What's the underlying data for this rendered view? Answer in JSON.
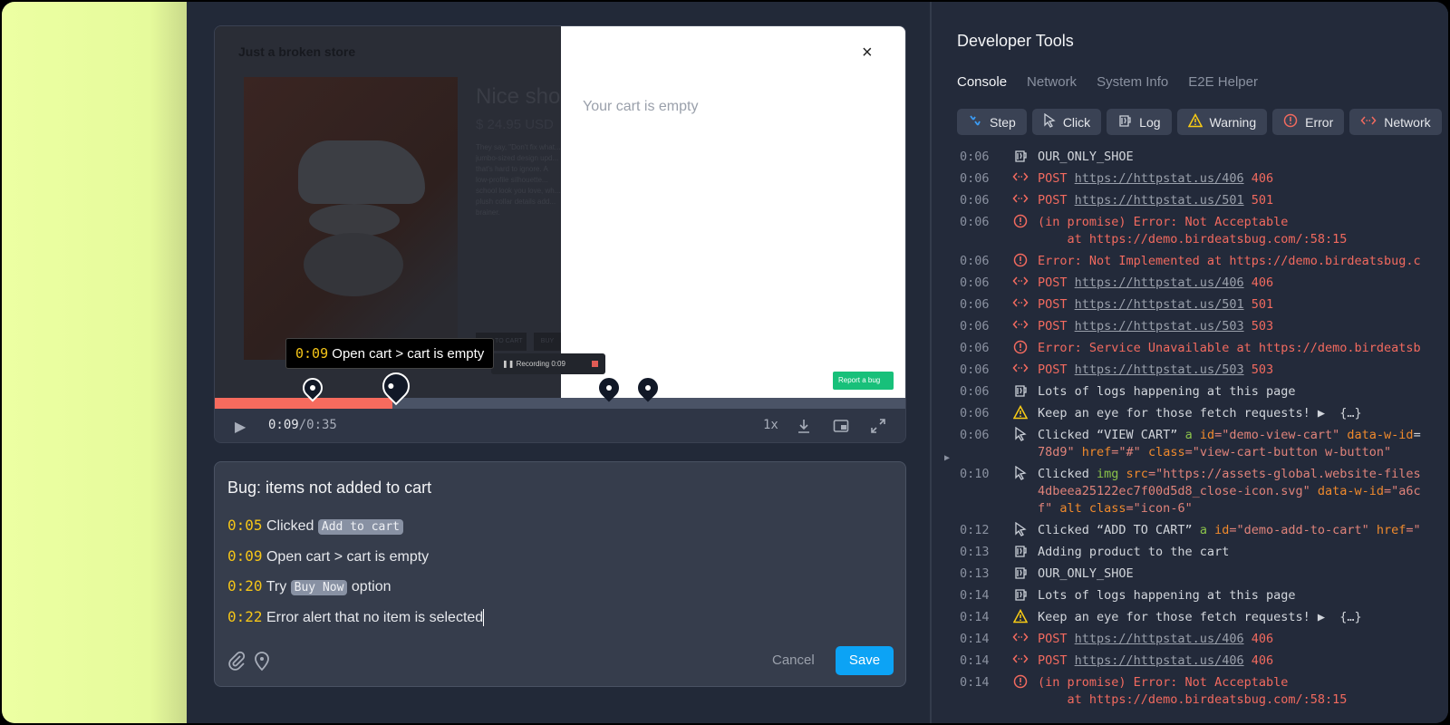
{
  "video": {
    "store_title": "Just a broken store",
    "product_title": "Nice sho",
    "price": "$ 24.95 USD",
    "description": "They say, \"Don't fix what... jumbo-sized design upd... that's hard to ignore. A low-profile silhouette... school look you love, wh... plush collar details add... brainer.",
    "add_to_cart_btn": "ADD TO CART",
    "buy_now_btn": "BUY NOW",
    "cart_empty": "Your cart is empty",
    "close_glyph": "×",
    "report_bug": "Report a bug",
    "recording_label": "Recording 0:09",
    "tooltip_time": "0:09",
    "tooltip_text": "Open cart > cart is empty",
    "progress_fraction": 0.257,
    "markers_seconds": [
      4,
      9,
      20,
      22
    ],
    "current_time": "0:09",
    "duration": "/0:35",
    "speed": "1x",
    "progress_color": "#f66b5e"
  },
  "notes": {
    "title": "Bug: items not added to cart",
    "lines": [
      {
        "time": "0:05",
        "pre": "Clicked",
        "chip": "Add to cart",
        "post": ""
      },
      {
        "time": "0:09",
        "pre": "Open cart > cart is empty",
        "chip": "",
        "post": ""
      },
      {
        "time": "0:20",
        "pre": "Try",
        "chip": "Buy Now",
        "post": "option"
      },
      {
        "time": "0:22",
        "pre": "Error alert that no item is selected",
        "chip": "",
        "post": ""
      }
    ],
    "cancel": "Cancel",
    "save": "Save",
    "save_color": "#0ca3f5"
  },
  "devtools": {
    "title": "Developer Tools",
    "tabs": [
      "Console",
      "Network",
      "System Info",
      "E2E Helper"
    ],
    "active_tab": "Console",
    "filters": [
      {
        "label": "Step",
        "icon": "step-icon"
      },
      {
        "label": "Click",
        "icon": "cursor-icon"
      },
      {
        "label": "Log",
        "icon": "log-icon"
      },
      {
        "label": "Warning",
        "icon": "warning-icon"
      },
      {
        "label": "Error",
        "icon": "error-icon"
      },
      {
        "label": "Network",
        "icon": "network-icon"
      }
    ],
    "rows": [
      {
        "time": "0:06",
        "type": "log",
        "lines": [
          [
            [
              "OUR_ONLY_SHOE",
              "text"
            ]
          ]
        ]
      },
      {
        "time": "0:06",
        "type": "network",
        "lines": [
          [
            [
              "POST ",
              "red"
            ],
            [
              "https://httpstat.us/406",
              "link"
            ],
            [
              " 406",
              "red"
            ]
          ]
        ]
      },
      {
        "time": "0:06",
        "type": "network",
        "lines": [
          [
            [
              "POST ",
              "red"
            ],
            [
              "https://httpstat.us/501",
              "link"
            ],
            [
              " 501",
              "red"
            ]
          ]
        ]
      },
      {
        "time": "0:06",
        "type": "error",
        "lines": [
          [
            [
              "(in promise) Error: Not Acceptable",
              "red"
            ]
          ],
          [
            [
              "    at https://demo.birdeatsbug.com/:58:15",
              "red"
            ]
          ]
        ]
      },
      {
        "time": "0:06",
        "type": "error",
        "lines": [
          [
            [
              "Error: Not Implemented at https://demo.birdeatsbug.c",
              "red"
            ]
          ]
        ]
      },
      {
        "time": "0:06",
        "type": "network",
        "lines": [
          [
            [
              "POST ",
              "red"
            ],
            [
              "https://httpstat.us/406",
              "link"
            ],
            [
              " 406",
              "red"
            ]
          ]
        ]
      },
      {
        "time": "0:06",
        "type": "network",
        "lines": [
          [
            [
              "POST ",
              "red"
            ],
            [
              "https://httpstat.us/501",
              "link"
            ],
            [
              " 501",
              "red"
            ]
          ]
        ]
      },
      {
        "time": "0:06",
        "type": "network",
        "lines": [
          [
            [
              "POST ",
              "red"
            ],
            [
              "https://httpstat.us/503",
              "link"
            ],
            [
              " 503",
              "red"
            ]
          ]
        ]
      },
      {
        "time": "0:06",
        "type": "error",
        "lines": [
          [
            [
              "Error: Service Unavailable at https://demo.birdeatsb",
              "red"
            ]
          ]
        ]
      },
      {
        "time": "0:06",
        "type": "network",
        "lines": [
          [
            [
              "POST ",
              "red"
            ],
            [
              "https://httpstat.us/503",
              "link"
            ],
            [
              " 503",
              "red"
            ]
          ]
        ]
      },
      {
        "time": "0:06",
        "type": "log",
        "lines": [
          [
            [
              "Lots of logs happening at this page",
              "text"
            ]
          ]
        ]
      },
      {
        "time": "0:06",
        "type": "warning",
        "lines": [
          [
            [
              "Keep an eye for those fetch requests! ▶  {…}",
              "text"
            ]
          ]
        ]
      },
      {
        "time": "0:06",
        "type": "click",
        "lines": [
          [
            [
              "Clicked “VIEW CART” ",
              "text"
            ],
            [
              "a ",
              "tag"
            ],
            [
              "id",
              "attr"
            ],
            [
              "=\"demo-view-cart\" ",
              "val"
            ],
            [
              "data-w-id",
              "attr"
            ],
            [
              "=",
              "text"
            ]
          ],
          [
            [
              "78d9\" ",
              "val"
            ],
            [
              "href",
              "attr"
            ],
            [
              "=\"#\" ",
              "val"
            ],
            [
              "class",
              "attr"
            ],
            [
              "=\"view-cart-button w-button\"",
              "val"
            ]
          ]
        ]
      },
      {
        "time": "0:10",
        "type": "click",
        "lines": [
          [
            [
              "Clicked ",
              "text"
            ],
            [
              "img ",
              "tag"
            ],
            [
              "src",
              "attr"
            ],
            [
              "=\"https://assets-global.website-files",
              "val"
            ]
          ],
          [
            [
              "4dbeea25122ec7f00d5d8_close-icon.svg\" ",
              "val"
            ],
            [
              "data-w-id",
              "attr"
            ],
            [
              "=\"a6c",
              "val"
            ]
          ],
          [
            [
              "f\" ",
              "val"
            ],
            [
              "alt class",
              "attr"
            ],
            [
              "=\"icon-6\"",
              "val"
            ]
          ]
        ]
      },
      {
        "time": "0:12",
        "type": "click",
        "lines": [
          [
            [
              "Clicked “ADD TO CART” ",
              "text"
            ],
            [
              "a ",
              "tag"
            ],
            [
              "id",
              "attr"
            ],
            [
              "=\"demo-add-to-cart\" ",
              "val"
            ],
            [
              "href",
              "attr"
            ],
            [
              "=\"",
              "val"
            ]
          ]
        ]
      },
      {
        "time": "0:13",
        "type": "log",
        "lines": [
          [
            [
              "Adding product to the cart",
              "text"
            ]
          ]
        ]
      },
      {
        "time": "0:13",
        "type": "log",
        "lines": [
          [
            [
              "OUR_ONLY_SHOE",
              "text"
            ]
          ]
        ]
      },
      {
        "time": "0:14",
        "type": "log",
        "lines": [
          [
            [
              "Lots of logs happening at this page",
              "text"
            ]
          ]
        ]
      },
      {
        "time": "0:14",
        "type": "warning",
        "lines": [
          [
            [
              "Keep an eye for those fetch requests! ▶  {…}",
              "text"
            ]
          ]
        ]
      },
      {
        "time": "0:14",
        "type": "network",
        "lines": [
          [
            [
              "POST ",
              "red"
            ],
            [
              "https://httpstat.us/406",
              "link"
            ],
            [
              " 406",
              "red"
            ]
          ]
        ]
      },
      {
        "time": "0:14",
        "type": "network",
        "lines": [
          [
            [
              "POST ",
              "red"
            ],
            [
              "https://httpstat.us/406",
              "link"
            ],
            [
              " 406",
              "red"
            ]
          ]
        ]
      },
      {
        "time": "0:14",
        "type": "error",
        "lines": [
          [
            [
              "(in promise) Error: Not Acceptable",
              "red"
            ]
          ],
          [
            [
              "    at https://demo.birdeatsbug.com/:58:15",
              "red"
            ]
          ]
        ]
      }
    ],
    "colors": {
      "error": "#f26a5f",
      "warning": "#facc15",
      "step": "#3b9cf5"
    }
  }
}
